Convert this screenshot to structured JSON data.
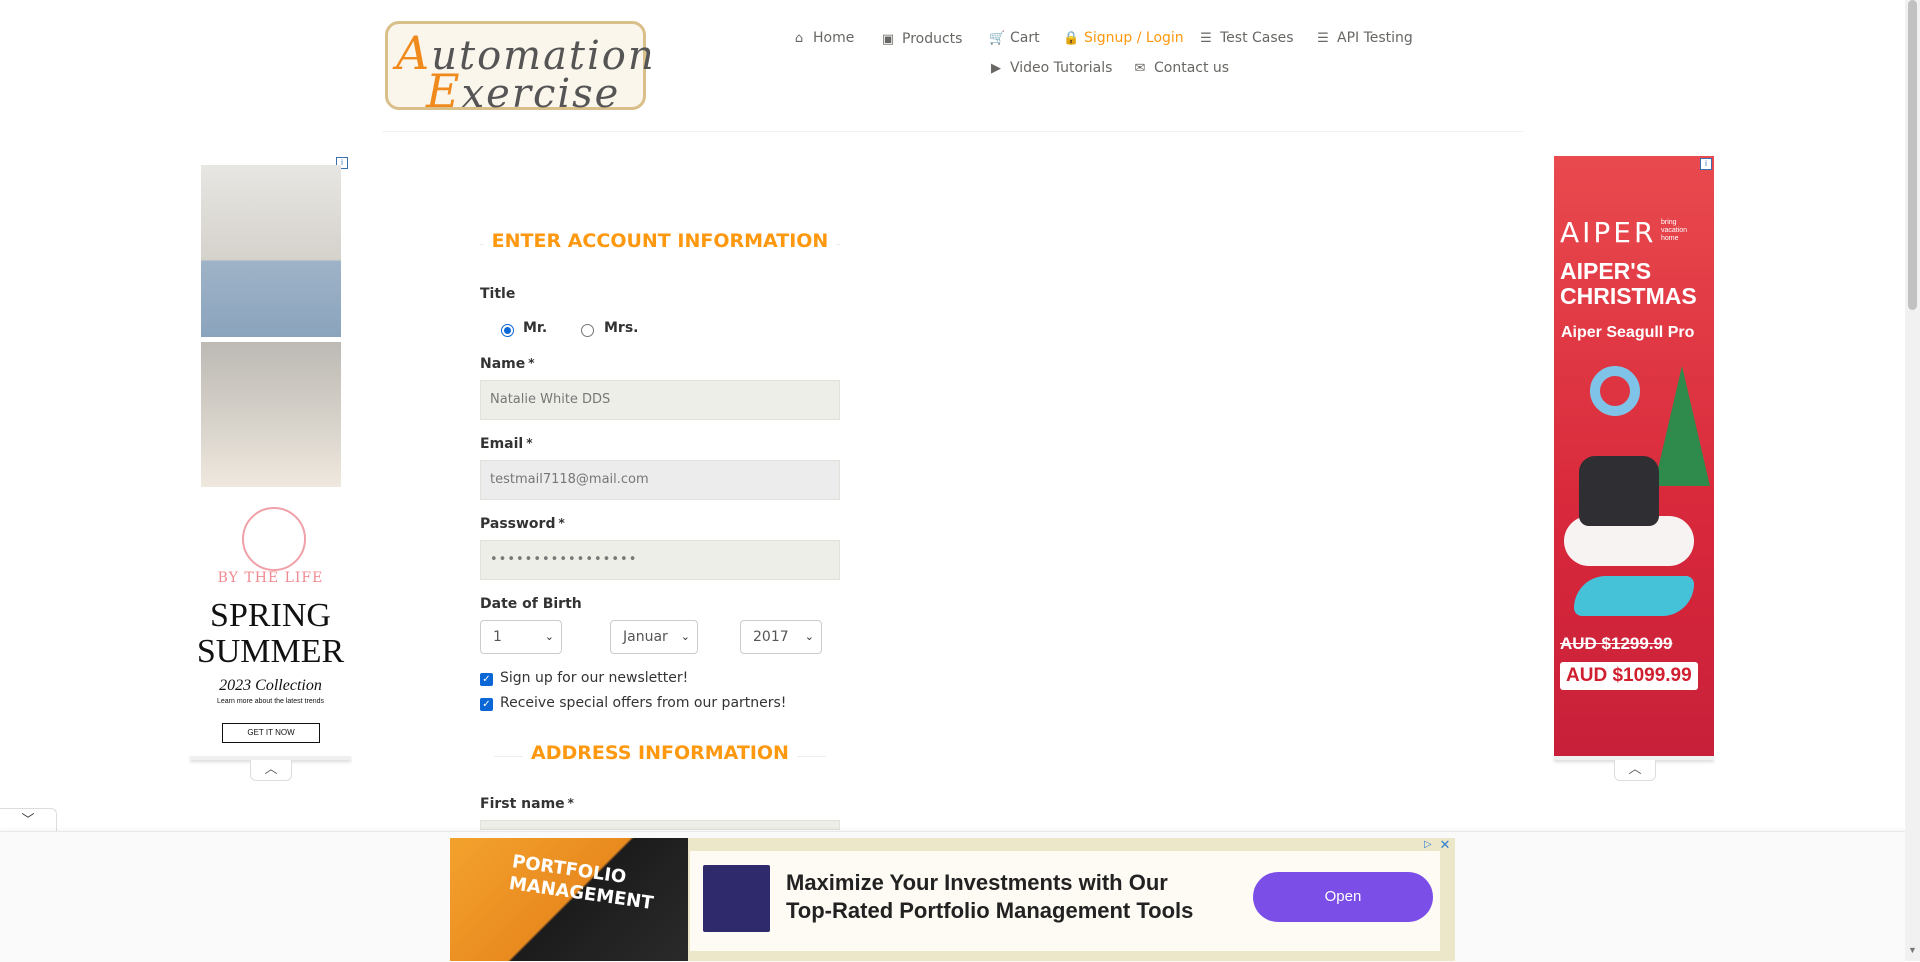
{
  "logo": {
    "line1_cap": "A",
    "line1_rest": "utomation",
    "line2_cap": "E",
    "line2_rest": "xercise"
  },
  "nav": [
    {
      "label": "Home",
      "icon": "home-icon",
      "glyph": "⌂"
    },
    {
      "label": "Products",
      "icon": "product-icon",
      "glyph": "▣"
    },
    {
      "label": "Cart",
      "icon": "cart-icon",
      "glyph": "🛒"
    },
    {
      "label": "Signup / Login",
      "icon": "lock-icon",
      "glyph": "🔒"
    },
    {
      "label": "Test Cases",
      "icon": "list-icon",
      "glyph": "☰"
    },
    {
      "label": "API Testing",
      "icon": "list-icon",
      "glyph": "☰"
    },
    {
      "label": "Video Tutorials",
      "icon": "youtube-icon",
      "glyph": "▶"
    },
    {
      "label": "Contact us",
      "icon": "envelope-icon",
      "glyph": "✉"
    }
  ],
  "colors": {
    "accent": "#fe980f",
    "nav_text": "#696763",
    "input_bg": "#eeeee8"
  },
  "form": {
    "section_title": "ENTER ACCOUNT INFORMATION",
    "title_label": "Title",
    "title_options": [
      "Mr.",
      "Mrs."
    ],
    "title_selected": "Mr.",
    "name_label": "Name",
    "name_value": "Natalie White DDS",
    "email_label": "Email",
    "email_value": "testmail7118@mail.com",
    "password_label": "Password",
    "password_value": "•••••••••••••••••",
    "required_mark": "*",
    "dob_label": "Date of Birth",
    "dob_day": "1",
    "dob_month": "Januar",
    "dob_year": "2017",
    "newsletter_label": "Sign up for our newsletter!",
    "newsletter_checked": true,
    "offers_label": "Receive special offers from our partners!",
    "offers_checked": true,
    "address_title": "ADDRESS INFORMATION",
    "first_name_label": "First name"
  },
  "ad_left": {
    "brand": "BY THE LIFE",
    "headline": "SPRING SUMMER",
    "collection": "2023 Collection",
    "tagline": "Learn more about the latest trends",
    "cta": "GET IT NOW"
  },
  "ad_right": {
    "brand": "AIPER",
    "tagline": "bring vacation home",
    "headline": "AIPER'S CHRISTMAS",
    "product": "Aiper Seagull Pro",
    "old_price": "AUD $1299.99",
    "new_price": "AUD $1099.99"
  },
  "ad_bottom": {
    "image_text": "PORTFOLIO MANAGEMENT",
    "headline": "Maximize Your Investments with Our Top-Rated Portfolio Management Tools",
    "button": "Open"
  }
}
